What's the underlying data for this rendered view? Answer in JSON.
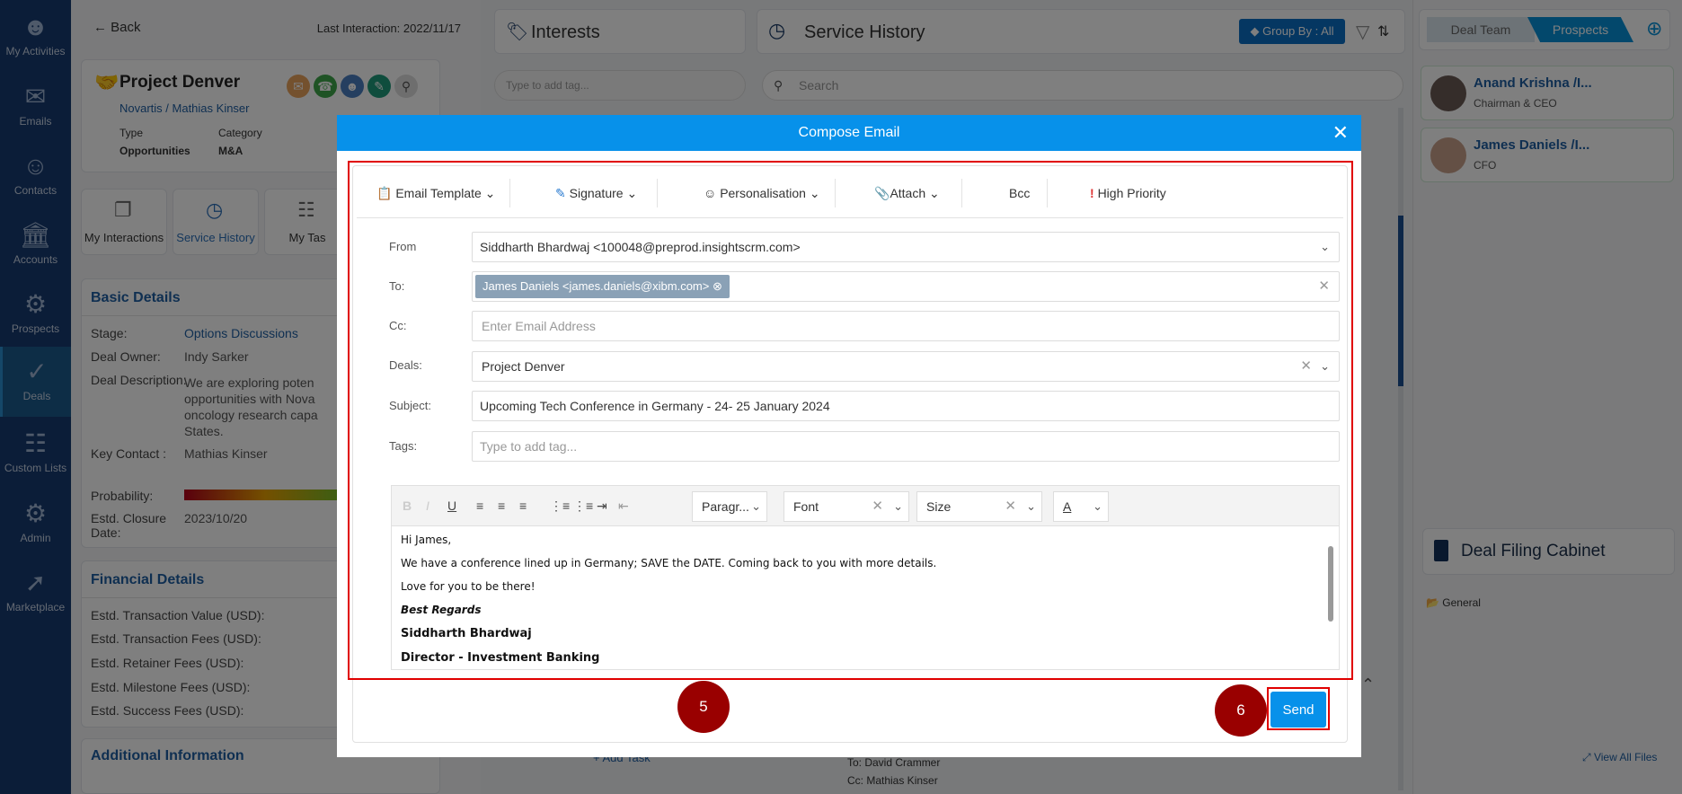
{
  "sidebar": {
    "items": [
      {
        "label": "My Activities",
        "icon": "user-check-icon"
      },
      {
        "label": "Emails",
        "icon": "envelope-icon"
      },
      {
        "label": "Contacts",
        "icon": "contact-icon"
      },
      {
        "label": "Accounts",
        "icon": "bank-icon"
      },
      {
        "label": "Prospects",
        "icon": "chart-gear-icon"
      },
      {
        "label": "Deals",
        "icon": "handshake-icon",
        "active": true
      },
      {
        "label": "Custom Lists",
        "icon": "clipboard-list-icon"
      },
      {
        "label": "Admin",
        "icon": "user-gear-icon"
      },
      {
        "label": "Marketplace",
        "icon": "marketplace-icon"
      }
    ]
  },
  "left": {
    "back": "Back",
    "last_interaction": "Last Interaction: 2022/11/17",
    "deal_title": "Project Denver",
    "deal_sub": "Novartis / Mathias Kinser",
    "type_label": "Type",
    "type_value": "Opportunities",
    "category_label": "Category",
    "category_value": "M&A",
    "tabs": [
      "My Interactions",
      "Service History",
      "My Tas"
    ],
    "basic_title": "Basic Details",
    "basic": [
      {
        "k": "Stage:",
        "v": "Options Discussions"
      },
      {
        "k": "Deal Owner:",
        "v": "Indy Sarker"
      },
      {
        "k": "Deal Description:",
        "v": "We are exploring poten opportunities with Nova oncology research capa States."
      },
      {
        "k": "Key Contact :",
        "v": "Mathias Kinser"
      }
    ],
    "probability_label": "Probability:",
    "closure_label": "Estd. Closure Date:",
    "closure_value": "2023/10/20",
    "financial_title": "Financial Details",
    "financial": [
      "Estd. Transaction Value (USD):",
      "Estd. Transaction Fees (USD):",
      "Estd. Retainer Fees (USD):",
      "Estd. Milestone Fees (USD):",
      "Estd. Success Fees (USD):"
    ],
    "additional_title": "Additional Information"
  },
  "interests": {
    "title": "Interests",
    "placeholder": "Type to add tag...",
    "add_task": "+ Add Task"
  },
  "service": {
    "title": "Service History",
    "group_by": "Group By : All",
    "search_placeholder": "Search",
    "to_line": "To: David Crammer",
    "cc_line": "Cc: Mathias Kinser"
  },
  "right": {
    "tabs": [
      "Deal Team",
      "Prospects"
    ],
    "prospects": [
      {
        "name": "Anand Krishna /I...",
        "role": "Chairman & CEO"
      },
      {
        "name": "James Daniels /I...",
        "role": "CFO"
      }
    ],
    "cabinet_title": "Deal Filing Cabinet",
    "folder": "General",
    "view_all": "View All Files"
  },
  "modal": {
    "title": "Compose Email",
    "toolbar": {
      "template": "Email Template",
      "signature": "Signature",
      "personalisation": "Personalisation",
      "attach": "Attach",
      "bcc": "Bcc",
      "priority": "High Priority"
    },
    "from_label": "From",
    "from_value": "Siddharth Bhardwaj <100048@preprod.insightscrm.com>",
    "to_label": "To:",
    "to_chip": "James Daniels <james.daniels@xibm.com>",
    "cc_label": "Cc:",
    "cc_placeholder": "Enter Email Address",
    "deals_label": "Deals:",
    "deals_value": "Project Denver",
    "subject_label": "Subject:",
    "subject_value": "Upcoming Tech Conference in Germany - 24- 25 January 2024",
    "tags_label": "Tags:",
    "tags_placeholder": "Type to add tag...",
    "editor": {
      "paragraph": "Paragr...",
      "font": "Font",
      "size": "Size",
      "color_letter": "A"
    },
    "body": {
      "greeting": "Hi James,",
      "line1": "We have a conference lined up in Germany; SAVE the DATE. Coming back to you with more details.",
      "line2": "Love for you to be there!",
      "regards": "Best Regards",
      "name": "Siddharth Bhardwaj",
      "title": "Director - Investment Banking"
    },
    "send": "Send"
  },
  "markers": [
    "5",
    "6"
  ],
  "colors": {
    "accent": "#0791ea",
    "sidebar": "#163a70",
    "marker": "#990000",
    "highlight": "#e00000"
  }
}
